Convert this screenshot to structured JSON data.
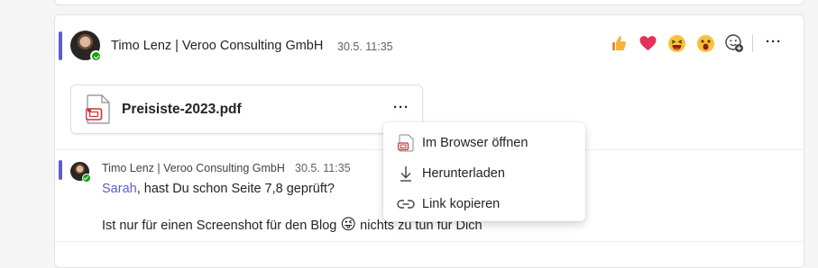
{
  "post": {
    "author": "Timo Lenz | Veroo Consulting GmbH",
    "time": "30.5. 11:35",
    "reactions": [
      {
        "name": "like",
        "glyph": "👍"
      },
      {
        "name": "heart",
        "glyph": "❤️"
      },
      {
        "name": "laugh",
        "glyph": "😆"
      },
      {
        "name": "surprised",
        "glyph": "😮"
      }
    ],
    "attachment": {
      "file_name": "Preisiste-2023.pdf",
      "file_icon": "pdf-file-icon"
    }
  },
  "context_menu": {
    "items": [
      {
        "label": "Im Browser öffnen",
        "icon": "open-in-browser-icon"
      },
      {
        "label": "Herunterladen",
        "icon": "download-icon"
      },
      {
        "label": "Link kopieren",
        "icon": "link-icon"
      }
    ]
  },
  "reply": {
    "author": "Timo Lenz | Veroo Consulting GmbH",
    "time": "30.5. 11:35",
    "mention": "Sarah",
    "line1_rest": ", hast Du schon Seite 7,8 geprüft?",
    "line2_start": "Ist nur für einen Screenshot für den Blog",
    "line2_emoji": "😜",
    "line2_end": "nichts zu tun für Dich"
  },
  "colors": {
    "accent": "#5b5fc7",
    "presence_available": "#13a10e",
    "heart": "#e3325b"
  }
}
